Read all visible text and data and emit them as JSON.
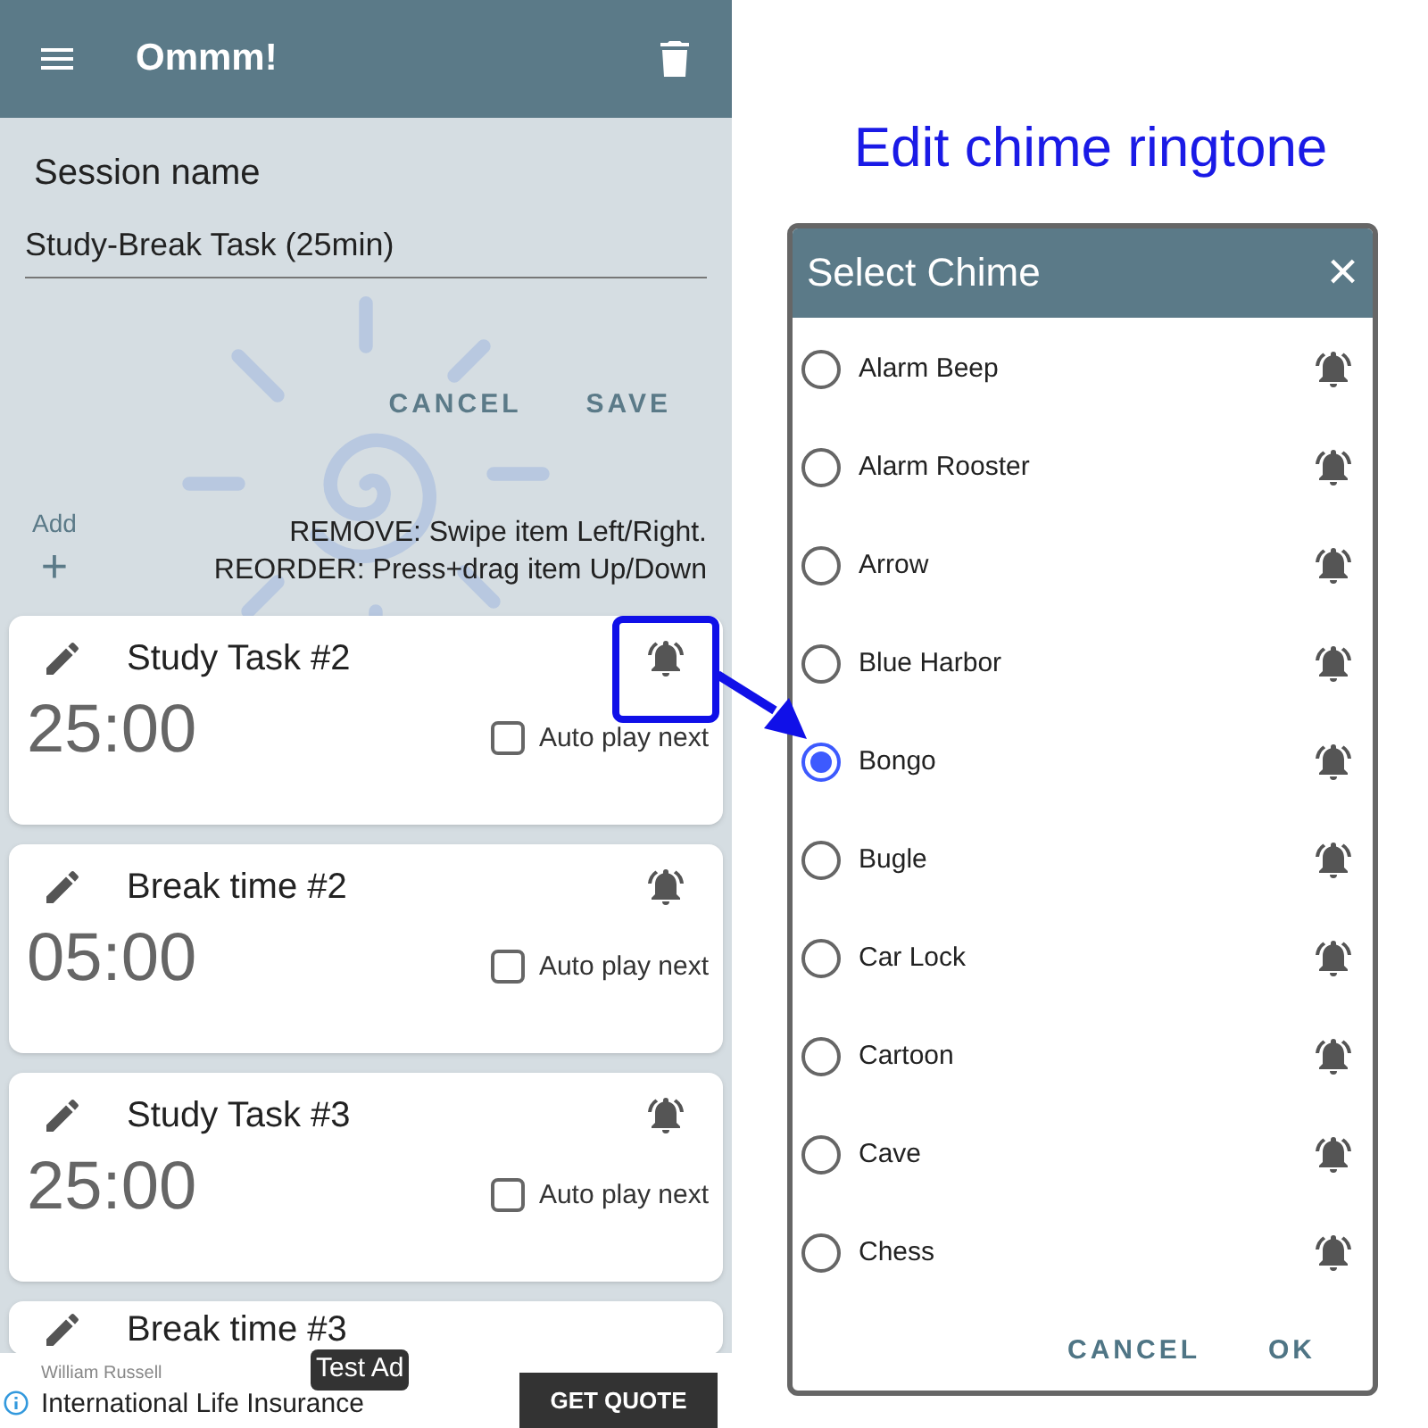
{
  "app_bar": {
    "title": "Ommm!"
  },
  "session": {
    "label": "Session name",
    "value": "Study-Break Task (25min)",
    "buttons": [
      "CANCEL",
      "SAVE"
    ]
  },
  "add": {
    "label": "Add",
    "icon": "+"
  },
  "hints": [
    "REMOVE: Swipe item Left/Right.",
    "REORDER: Press+drag item Up/Down"
  ],
  "tasks": [
    {
      "title": "Study Task #2",
      "time": "25:00",
      "auto_play_label": "Auto play next",
      "auto_play": false,
      "highlighted": true
    },
    {
      "title": "Break time #2",
      "time": "05:00",
      "auto_play_label": "Auto play next",
      "auto_play": false,
      "highlighted": false
    },
    {
      "title": "Study Task #3",
      "time": "25:00",
      "auto_play_label": "Auto play next",
      "auto_play": false,
      "highlighted": false
    },
    {
      "title": "Break time #3"
    }
  ],
  "ad": {
    "advertiser": "William Russell",
    "headline": "International Life Insurance",
    "badge": "Test Ad",
    "button": "GET QUOTE"
  },
  "caption": "Edit chime ringtone",
  "dialog": {
    "title": "Select Chime",
    "close": "×",
    "options": [
      {
        "label": "Alarm Beep",
        "selected": false
      },
      {
        "label": "Alarm Rooster",
        "selected": false
      },
      {
        "label": "Arrow",
        "selected": false
      },
      {
        "label": "Blue Harbor",
        "selected": false
      },
      {
        "label": "Bongo",
        "selected": true
      },
      {
        "label": "Bugle",
        "selected": false
      },
      {
        "label": "Car Lock",
        "selected": false
      },
      {
        "label": "Cartoon",
        "selected": false
      },
      {
        "label": "Cave",
        "selected": false
      },
      {
        "label": "Chess",
        "selected": false
      }
    ],
    "buttons": [
      "CANCEL",
      "OK"
    ]
  }
}
